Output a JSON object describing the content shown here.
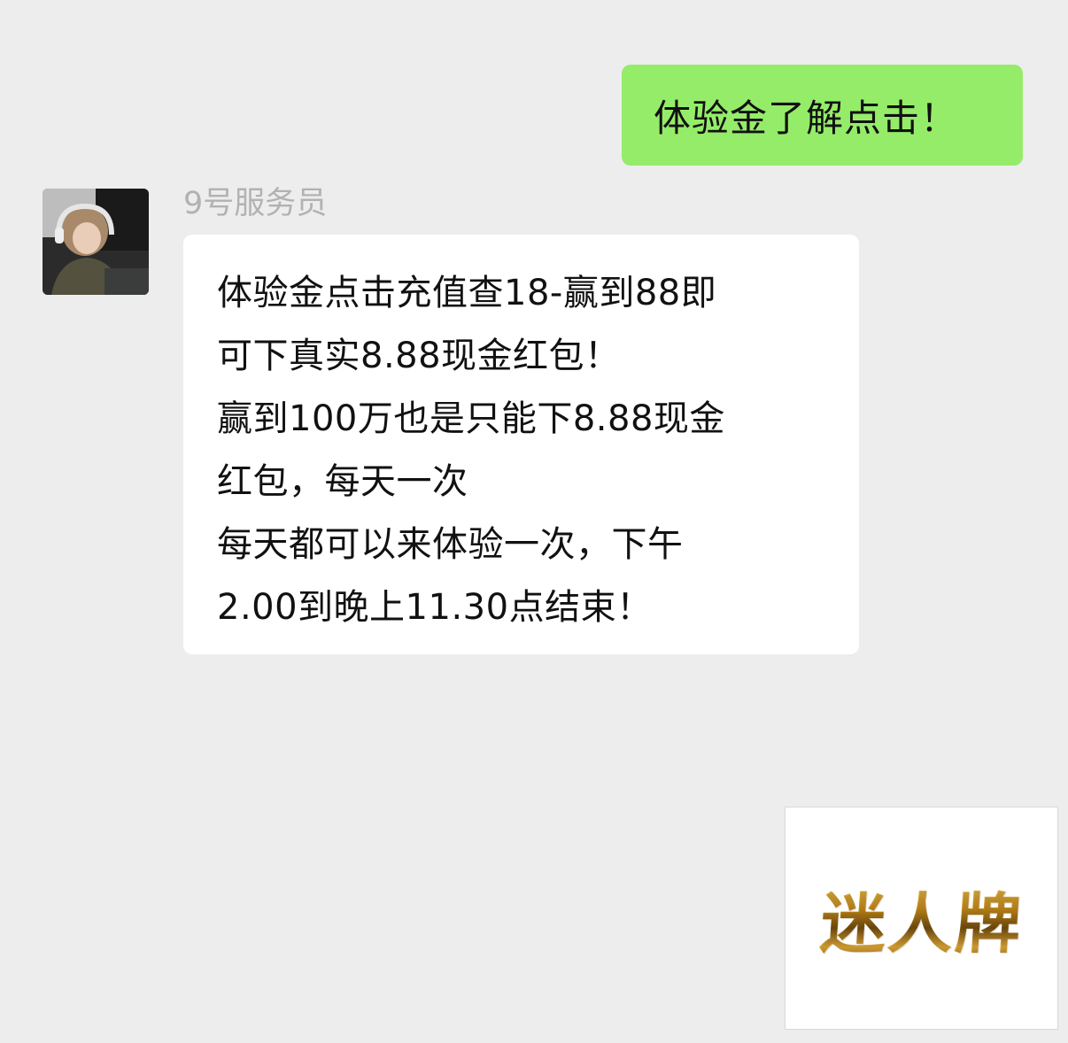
{
  "outgoing_message": {
    "text": "体验金了解点击！"
  },
  "incoming_message": {
    "sender_name": "9号服务员",
    "lines": [
      "体验金点击充值查18-赢到88即",
      "可下真实8.88现金红包！",
      "赢到100万也是只能下8.88现金",
      "红包，每天一次",
      "每天都可以来体验一次，下午",
      "2.00到晚上11.30点结束！"
    ]
  },
  "watermark": {
    "text": "迷人牌"
  },
  "colors": {
    "background": "#ededed",
    "outgoing_bubble": "#95ec69",
    "incoming_bubble": "#ffffff",
    "sender_name": "#b2b2b2",
    "logo_gold": "#c8951f"
  },
  "icons": {
    "avatar": "avatar-photo"
  }
}
